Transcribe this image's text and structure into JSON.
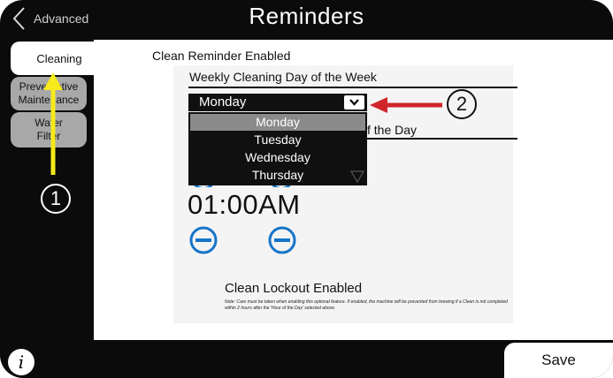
{
  "header": {
    "back_label": "Advanced",
    "title": "Reminders"
  },
  "tabs": [
    {
      "label": "Cleaning",
      "active": true
    },
    {
      "label": "Preventative Maintenance",
      "line1": "Preventative",
      "line2": "Maintenance",
      "active": false
    },
    {
      "label": "Water Filter",
      "line1": "Water",
      "line2": "Filter",
      "active": false
    }
  ],
  "cleaning": {
    "reminder_enabled_label": "Clean Reminder Enabled",
    "weekly_day_label": "Weekly Cleaning Day of the Week",
    "selected_day": "Monday",
    "day_options": [
      "Monday",
      "Tuesday",
      "Wednesday",
      "Thursday"
    ],
    "hour_label_partial": "f the Day",
    "time_value": "01:00AM",
    "lockout_label": "Clean Lockout Enabled",
    "lockout_note": "Note: Care must be taken when enabling this optional feature.  If enabled, the machine will be prevented from brewing if a Clean is not completed within 2 hours after the 'Hour of the Day' selected above."
  },
  "footer": {
    "info_glyph": "i",
    "save_label": "Save"
  },
  "annotations": {
    "callout_1": "1",
    "callout_2": "2",
    "arrow_1_color": "#f7ea1c",
    "arrow_2_color": "#d0262b"
  },
  "colors": {
    "accent_blue": "#1674c8",
    "frame": "#0b0b0b",
    "tab_inactive": "#a8a8a8"
  }
}
